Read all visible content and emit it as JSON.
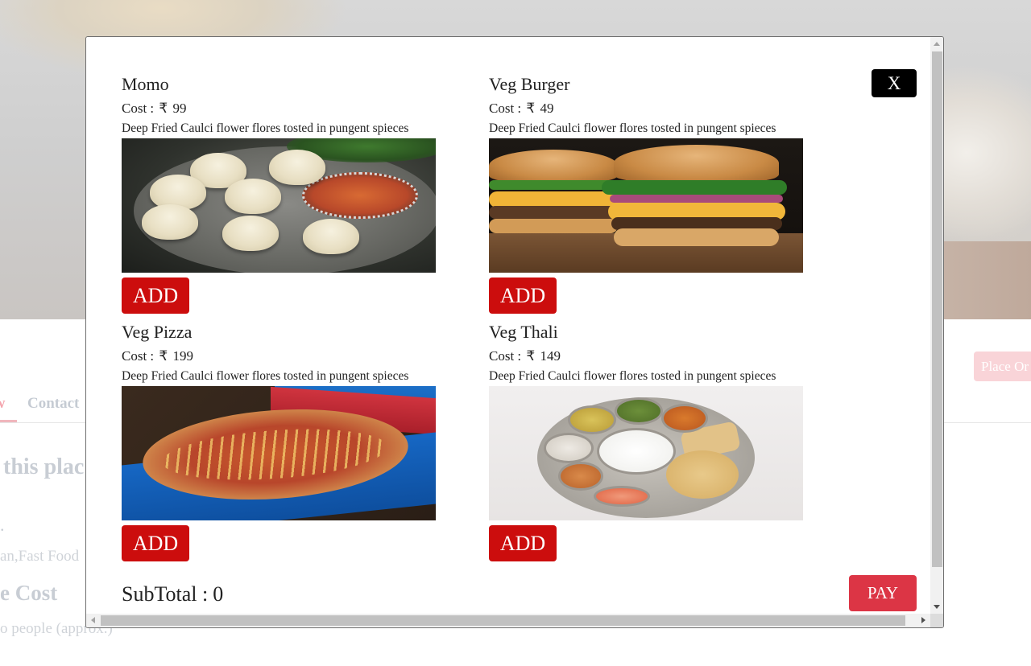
{
  "background": {
    "tabs": {
      "active_fragment": "w",
      "contact": "Contact"
    },
    "heading_fragment": "this plac",
    "dot": ".",
    "cuisine_fragment": "an,Fast Food",
    "cost_heading_fragment": "e Cost",
    "cost_sub_fragment": "o people (approx.)",
    "place_order_fragment": "Place Or"
  },
  "modal": {
    "close_label": "X",
    "items": [
      {
        "name": "Momo",
        "cost_label": "Cost :",
        "currency": "₹",
        "price": "99",
        "description": "Deep Fried Caulci flower flores tosted in pungent spieces",
        "add_label": "ADD",
        "image_icon": "momo-image"
      },
      {
        "name": "Veg Burger",
        "cost_label": "Cost :",
        "currency": "₹",
        "price": "49",
        "description": "Deep Fried Caulci flower flores tosted in pungent spieces",
        "add_label": "ADD",
        "image_icon": "burger-image"
      },
      {
        "name": "Veg Pizza",
        "cost_label": "Cost :",
        "currency": "₹",
        "price": "199",
        "description": "Deep Fried Caulci flower flores tosted in pungent spieces",
        "add_label": "ADD",
        "image_icon": "pizza-image"
      },
      {
        "name": "Veg Thali",
        "cost_label": "Cost :",
        "currency": "₹",
        "price": "149",
        "description": "Deep Fried Caulci flower flores tosted in pungent spieces",
        "add_label": "ADD",
        "image_icon": "thali-image"
      }
    ],
    "subtotal_label": "SubTotal :",
    "subtotal_value": "0",
    "pay_label": "PAY"
  },
  "colors": {
    "add_button": "#cc0d0d",
    "pay_button": "#dc3545",
    "close_button": "#000000"
  }
}
